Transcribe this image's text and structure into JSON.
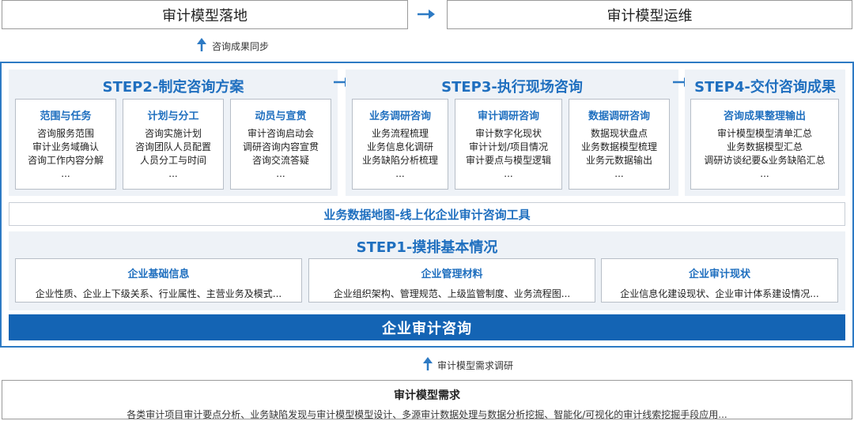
{
  "top": {
    "left_title": "审计模型落地",
    "right_title": "审计模型运维",
    "sync_label": "咨询成果同步"
  },
  "steps": {
    "step2": {
      "title": "STEP2-制定咨询方案",
      "cards": [
        {
          "title": "范围与任务",
          "lines": [
            "咨询服务范围",
            "审计业务域确认",
            "咨询工作内容分解",
            "..."
          ]
        },
        {
          "title": "计划与分工",
          "lines": [
            "咨询实施计划",
            "咨询团队人员配置",
            "人员分工与时间",
            "..."
          ]
        },
        {
          "title": "动员与宣贯",
          "lines": [
            "审计咨询启动会",
            "调研咨询内容宣贯",
            "咨询交流答疑",
            "..."
          ]
        }
      ]
    },
    "step3": {
      "title": "STEP3-执行现场咨询",
      "cards": [
        {
          "title": "业务调研咨询",
          "lines": [
            "业务流程梳理",
            "业务信息化调研",
            "业务缺陷分析梳理",
            "..."
          ]
        },
        {
          "title": "审计调研咨询",
          "lines": [
            "审计数字化现状",
            "审计计划/项目情况",
            "审计要点与模型逻辑",
            "..."
          ]
        },
        {
          "title": "数据调研咨询",
          "lines": [
            "数据现状盘点",
            "业务数据模型梳理",
            "业务元数据输出",
            "..."
          ]
        }
      ]
    },
    "step4": {
      "title": "STEP4-交付咨询成果",
      "cards": [
        {
          "title": "咨询成果整理输出",
          "lines": [
            "审计模型模型清单汇总",
            "业务数据模型汇总",
            "调研访谈纪要&业务缺陷汇总",
            "..."
          ]
        }
      ]
    },
    "tool": "业务数据地图-线上化企业审计咨询工具",
    "step1": {
      "title": "STEP1-摸排基本情况",
      "cards": [
        {
          "title": "企业基础信息",
          "line": "企业性质、企业上下级关系、行业属性、主营业务及模式..."
        },
        {
          "title": "企业管理材料",
          "line": "企业组织架构、管理规范、上级监管制度、业务流程图..."
        },
        {
          "title": "企业审计现状",
          "line": "企业信息化建设现状、企业审计体系建设情况..."
        }
      ]
    },
    "base": "企业审计咨询"
  },
  "bottom": {
    "research_label": "审计模型需求调研",
    "title": "审计模型需求",
    "desc": "各类审计项目审计要点分析、业务缺陷发现与审计模型模型设计、多源审计数据处理与数据分析挖掘、智能化/可视化的审计线索挖掘手段应用..."
  },
  "colors": {
    "accent": "#1f6fbf",
    "base_bar": "#1464b4",
    "frame": "#2d7ac4",
    "panel": "#eef2f7"
  }
}
